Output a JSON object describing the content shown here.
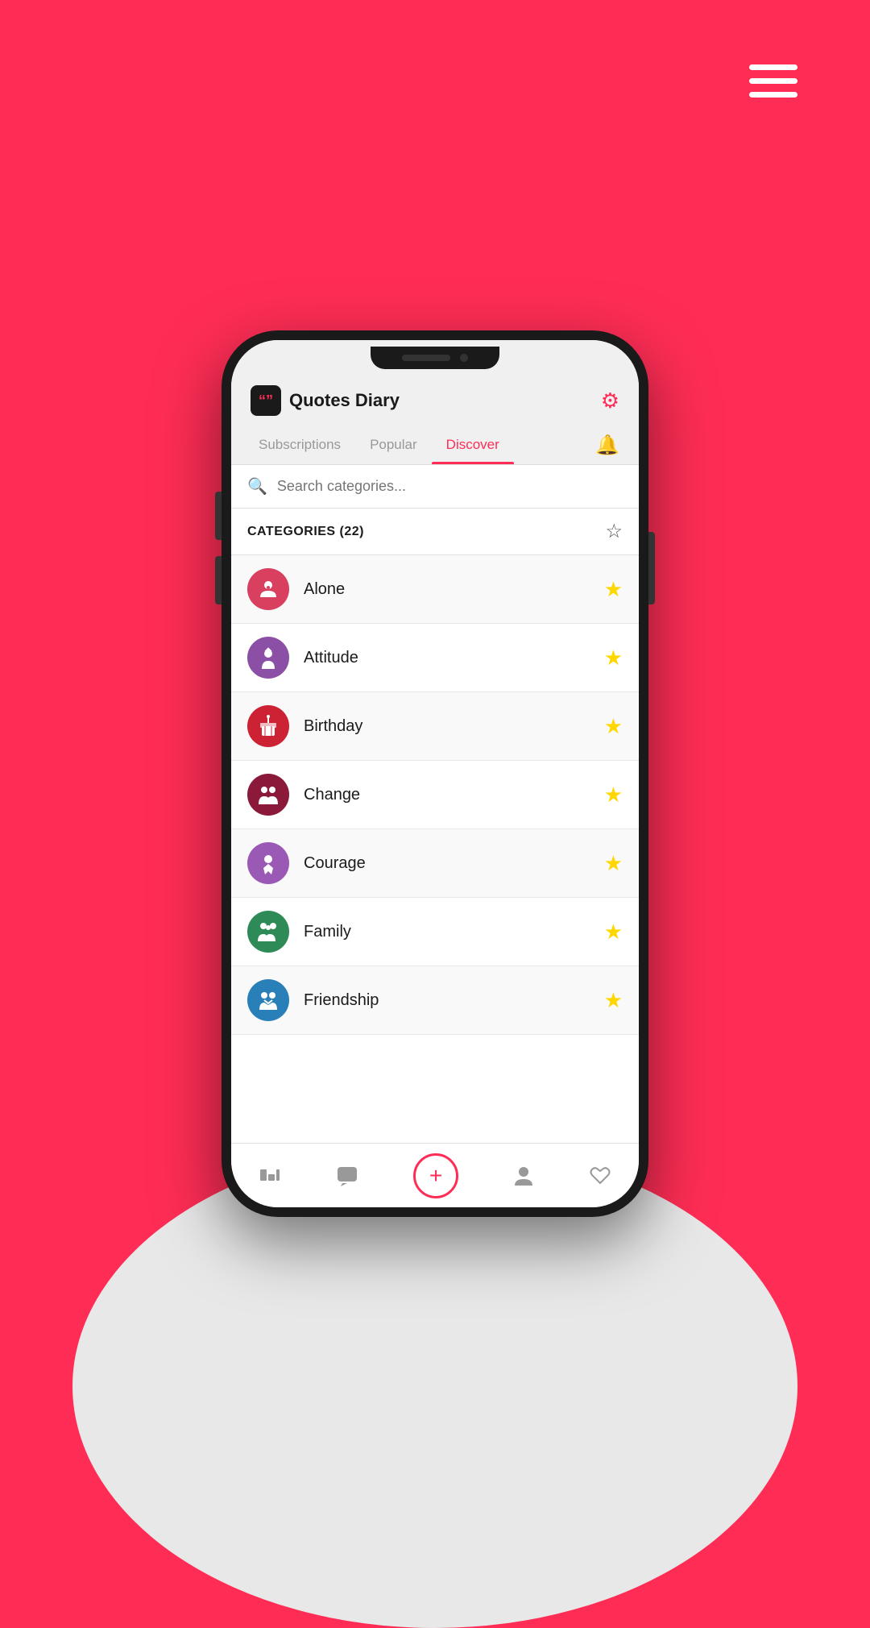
{
  "background": {
    "color": "#FF2D55"
  },
  "hamburger": {
    "lines": 3
  },
  "app": {
    "title": "Quotes Diary",
    "logo_text": "“”"
  },
  "tabs": [
    {
      "label": "Subscriptions",
      "active": false
    },
    {
      "label": "Popular",
      "active": false
    },
    {
      "label": "Discover",
      "active": true
    }
  ],
  "bell_icon": "🔔",
  "search": {
    "placeholder": "Search categories..."
  },
  "categories_header": {
    "title": "CATEGORIES (22)",
    "star_icon": "☆"
  },
  "categories": [
    {
      "name": "Alone",
      "icon_class": "icon-alone",
      "icon_emoji": "😔",
      "starred": true
    },
    {
      "name": "Attitude",
      "icon_class": "icon-attitude",
      "icon_emoji": "👑",
      "starred": true
    },
    {
      "name": "Birthday",
      "icon_class": "icon-birthday",
      "icon_emoji": "🎁",
      "starred": true
    },
    {
      "name": "Change",
      "icon_class": "icon-change",
      "icon_emoji": "🚶",
      "starred": true
    },
    {
      "name": "Courage",
      "icon_class": "icon-courage",
      "icon_emoji": "💪",
      "starred": true
    },
    {
      "name": "Family",
      "icon_class": "icon-family",
      "icon_emoji": "👨‍👩‍👧",
      "starred": true
    },
    {
      "name": "Friendship",
      "icon_class": "icon-friendship",
      "icon_emoji": "🤝",
      "starred": true
    }
  ],
  "bottom_nav": [
    {
      "icon": "⬛",
      "name": "home-nav",
      "label": ""
    },
    {
      "icon": "💬",
      "name": "chat-nav",
      "label": ""
    },
    {
      "icon": "+",
      "name": "add-nav",
      "label": "",
      "center": true
    },
    {
      "icon": "👤",
      "name": "profile-nav",
      "label": ""
    },
    {
      "icon": "♡",
      "name": "favorites-nav",
      "label": ""
    }
  ]
}
